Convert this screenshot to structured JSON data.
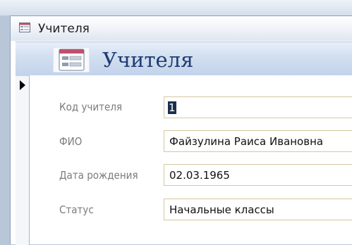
{
  "window": {
    "title": "Учителя",
    "icon": "form-icon"
  },
  "form_header": {
    "title": "Учителя",
    "icon": "form-icon"
  },
  "record_selector": {
    "icon": "current-record-arrow-icon"
  },
  "fields": [
    {
      "label": "Код учителя",
      "value": "1"
    },
    {
      "label": "ФИО",
      "value": "Файзулина Раиса Ивановна"
    },
    {
      "label": "Дата рождения",
      "value": "02.03.1965"
    },
    {
      "label": "Статус",
      "value": "Начальные классы"
    }
  ],
  "colors": {
    "header_title": "#1f3c72",
    "label": "#7b7b7b",
    "field_border": "#d5c7a2"
  }
}
